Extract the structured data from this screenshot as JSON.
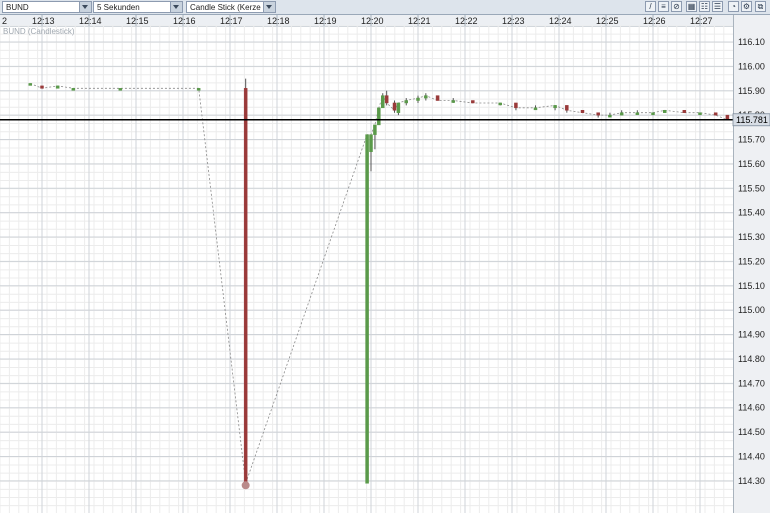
{
  "toolbar": {
    "instrument": "BUND",
    "interval": "5 Sekunden",
    "chart_type": "Candle Stick (Kerze"
  },
  "series_label": "BUND (Candlestick)",
  "time_axis": {
    "first_label": "2"
  },
  "last_price_label": "115.781",
  "colors": {
    "up": "#5a9a4a",
    "down": "#9a3a3a",
    "last_price_line": "#000000"
  },
  "chart_data": {
    "type": "candlestick",
    "title": "BUND (Candlestick)",
    "xlabels": [
      "12:13",
      "12:14",
      "12:15",
      "12:16",
      "12:17",
      "12:18",
      "12:19",
      "12:20",
      "12:21",
      "12:22",
      "12:23",
      "12:24",
      "12:25",
      "12:26",
      "12:27"
    ],
    "yticks": [
      116.1,
      116.0,
      115.9,
      115.8,
      115.7,
      115.6,
      115.5,
      115.4,
      115.3,
      115.2,
      115.1,
      115.0,
      114.9,
      114.8,
      114.7,
      114.6,
      114.5,
      114.4,
      114.3
    ],
    "ylim": [
      114.25,
      116.13
    ],
    "last_price": 115.781,
    "candles": [
      {
        "t": "12:12:45",
        "o": 115.93,
        "h": 115.93,
        "l": 115.93,
        "c": 115.93
      },
      {
        "t": "12:13:00",
        "o": 115.92,
        "h": 115.92,
        "l": 115.91,
        "c": 115.91
      },
      {
        "t": "12:13:20",
        "o": 115.91,
        "h": 115.92,
        "l": 115.91,
        "c": 115.92
      },
      {
        "t": "12:13:40",
        "o": 115.91,
        "h": 115.91,
        "l": 115.91,
        "c": 115.91
      },
      {
        "t": "12:14:40",
        "o": 115.91,
        "h": 115.91,
        "l": 115.91,
        "c": 115.91
      },
      {
        "t": "12:16:20",
        "o": 115.91,
        "h": 115.91,
        "l": 115.91,
        "c": 115.91
      },
      {
        "t": "12:17:20",
        "o": 115.91,
        "h": 115.95,
        "l": 114.29,
        "c": 114.29
      },
      {
        "t": "12:19:55",
        "o": 114.29,
        "h": 115.72,
        "l": 114.29,
        "c": 115.72
      },
      {
        "t": "12:20:00",
        "o": 115.65,
        "h": 115.72,
        "l": 115.57,
        "c": 115.72
      },
      {
        "t": "12:20:05",
        "o": 115.72,
        "h": 115.76,
        "l": 115.66,
        "c": 115.76
      },
      {
        "t": "12:20:10",
        "o": 115.76,
        "h": 115.83,
        "l": 115.76,
        "c": 115.83
      },
      {
        "t": "12:20:15",
        "o": 115.83,
        "h": 115.89,
        "l": 115.83,
        "c": 115.88
      },
      {
        "t": "12:20:20",
        "o": 115.88,
        "h": 115.9,
        "l": 115.84,
        "c": 115.85
      },
      {
        "t": "12:20:30",
        "o": 115.85,
        "h": 115.86,
        "l": 115.81,
        "c": 115.82
      },
      {
        "t": "12:20:35",
        "o": 115.81,
        "h": 115.85,
        "l": 115.8,
        "c": 115.85
      },
      {
        "t": "12:20:45",
        "o": 115.85,
        "h": 115.87,
        "l": 115.84,
        "c": 115.86
      },
      {
        "t": "12:21:00",
        "o": 115.86,
        "h": 115.88,
        "l": 115.85,
        "c": 115.87
      },
      {
        "t": "12:21:10",
        "o": 115.87,
        "h": 115.89,
        "l": 115.86,
        "c": 115.88
      },
      {
        "t": "12:21:25",
        "o": 115.88,
        "h": 115.88,
        "l": 115.86,
        "c": 115.86
      },
      {
        "t": "12:21:45",
        "o": 115.86,
        "h": 115.87,
        "l": 115.85,
        "c": 115.86
      },
      {
        "t": "12:22:10",
        "o": 115.86,
        "h": 115.86,
        "l": 115.85,
        "c": 115.85
      },
      {
        "t": "12:22:45",
        "o": 115.85,
        "h": 115.85,
        "l": 115.84,
        "c": 115.85
      },
      {
        "t": "12:23:05",
        "o": 115.85,
        "h": 115.85,
        "l": 115.82,
        "c": 115.83
      },
      {
        "t": "12:23:30",
        "o": 115.83,
        "h": 115.84,
        "l": 115.83,
        "c": 115.83
      },
      {
        "t": "12:23:55",
        "o": 115.83,
        "h": 115.84,
        "l": 115.82,
        "c": 115.84
      },
      {
        "t": "12:24:10",
        "o": 115.84,
        "h": 115.84,
        "l": 115.81,
        "c": 115.82
      },
      {
        "t": "12:24:30",
        "o": 115.82,
        "h": 115.82,
        "l": 115.81,
        "c": 115.81
      },
      {
        "t": "12:24:50",
        "o": 115.81,
        "h": 115.81,
        "l": 115.79,
        "c": 115.8
      },
      {
        "t": "12:25:05",
        "o": 115.8,
        "h": 115.81,
        "l": 115.8,
        "c": 115.8
      },
      {
        "t": "12:25:20",
        "o": 115.8,
        "h": 115.82,
        "l": 115.8,
        "c": 115.81
      },
      {
        "t": "12:25:40",
        "o": 115.81,
        "h": 115.82,
        "l": 115.81,
        "c": 115.81
      },
      {
        "t": "12:26:00",
        "o": 115.81,
        "h": 115.81,
        "l": 115.8,
        "c": 115.81
      },
      {
        "t": "12:26:15",
        "o": 115.81,
        "h": 115.82,
        "l": 115.81,
        "c": 115.82
      },
      {
        "t": "12:26:40",
        "o": 115.82,
        "h": 115.82,
        "l": 115.81,
        "c": 115.81
      },
      {
        "t": "12:27:00",
        "o": 115.81,
        "h": 115.81,
        "l": 115.8,
        "c": 115.81
      },
      {
        "t": "12:27:20",
        "o": 115.81,
        "h": 115.81,
        "l": 115.8,
        "c": 115.8
      },
      {
        "t": "12:27:35",
        "o": 115.8,
        "h": 115.8,
        "l": 115.78,
        "c": 115.78
      }
    ]
  }
}
